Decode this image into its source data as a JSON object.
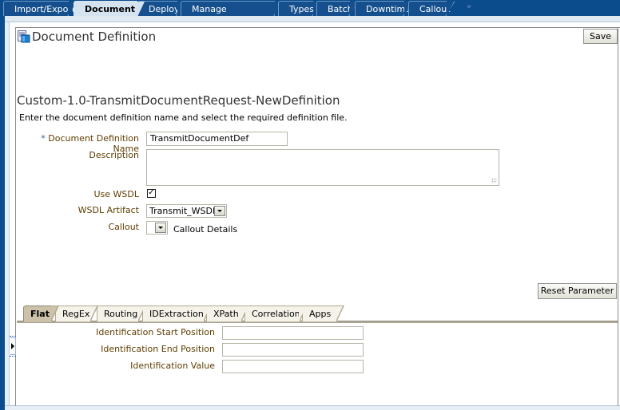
{
  "top_tabs": [
    {
      "label": "Import/Export",
      "active": false
    },
    {
      "label": "Document",
      "active": true
    },
    {
      "label": "Deploy",
      "active": false
    },
    {
      "label": "Manage Deployments",
      "active": false
    },
    {
      "label": "Types",
      "active": false
    },
    {
      "label": "Batch",
      "active": false
    },
    {
      "label": "Downtime",
      "active": false
    },
    {
      "label": "Callout",
      "active": false
    }
  ],
  "overflow_icon": "»",
  "page": {
    "title": "Document Definition",
    "icon": "document-definition-icon",
    "save_label": "Save"
  },
  "form": {
    "section_title": "Custom-1.0-TransmitDocumentRequest-NewDefinition",
    "instructions": "Enter the document definition name and select the required definition file.",
    "required_marker": "*",
    "name_label": "Document Definition Name",
    "name_value": "TransmitDocumentDef",
    "description_label": "Description",
    "description_value": "",
    "use_wsdl_label": "Use WSDL",
    "use_wsdl_checked": true,
    "use_wsdl_check_glyph": "✓",
    "wsdl_artifact_label": "WSDL Artifact",
    "wsdl_artifact_value": "Transmit_WSDL",
    "callout_label": "Callout",
    "callout_value": "",
    "callout_details_label": "Callout Details",
    "reset_label": "Reset Parameter"
  },
  "inner_tabs": [
    {
      "label": "Flat",
      "active": true
    },
    {
      "label": "RegEx",
      "active": false
    },
    {
      "label": "Routing",
      "active": false
    },
    {
      "label": "IDExtraction",
      "active": false
    },
    {
      "label": "XPath",
      "active": false
    },
    {
      "label": "Correlation",
      "active": false
    },
    {
      "label": "Apps",
      "active": false
    }
  ],
  "flat_fields": [
    {
      "label": "Identification Start Position",
      "value": ""
    },
    {
      "label": "Identification End Position",
      "value": ""
    },
    {
      "label": "Identification Value",
      "value": ""
    }
  ]
}
